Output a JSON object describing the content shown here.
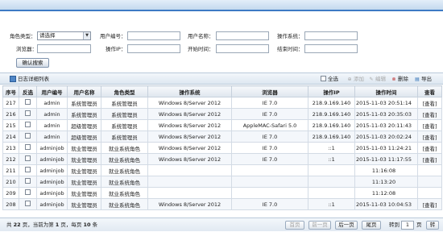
{
  "filter": {
    "role_type_label": "角色类型：",
    "role_type_value": "请选择",
    "user_id_label": "用户编号：",
    "user_name_label": "用户名称：",
    "os_label": "操作系统：",
    "browser_label": "浏览器：",
    "ip_label": "操作IP：",
    "start_time_label": "开始时间：",
    "end_time_label": "结束时间：",
    "search_button": "确认搜索"
  },
  "toolbar": {
    "title": "日志详细列表",
    "select_all": "全选",
    "add": "添加",
    "edit": "编辑",
    "delete": "删除",
    "export": "导出"
  },
  "columns": [
    "序号",
    "反选",
    "用户编号",
    "用户名称",
    "角色类型",
    "操作系统",
    "浏览器",
    "操作IP",
    "操作时间",
    "查看"
  ],
  "rows": [
    {
      "no": "217",
      "uid": "admin",
      "uname": "系统管理员",
      "role": "系统管理员",
      "os": "Windows 8/Server 2012",
      "browser": "IE 7.0",
      "ip": "218.9.169.140",
      "time": "2015-11-03 20:51:14",
      "view": "[查看]"
    },
    {
      "no": "216",
      "uid": "admin",
      "uname": "系统管理员",
      "role": "系统管理员",
      "os": "Windows 8/Server 2012",
      "browser": "IE 7.0",
      "ip": "218.9.169.140",
      "time": "2015-11-03 20:35:03",
      "view": "[查看]"
    },
    {
      "no": "215",
      "uid": "admin",
      "uname": "超级管理员",
      "role": "系统管理员",
      "os": "Windows 8/Server 2012",
      "browser": "AppleMAC-Safari 5.0",
      "ip": "218.9.169.140",
      "time": "2015-11-03 20:11:43",
      "view": "[查看]"
    },
    {
      "no": "214",
      "uid": "admin",
      "uname": "超级管理员",
      "role": "系统管理员",
      "os": "Windows 8/Server 2012",
      "browser": "IE 7.0",
      "ip": "218.9.169.140",
      "time": "2015-11-03 20:02:24",
      "view": "[查看]"
    },
    {
      "no": "213",
      "uid": "adminjob",
      "uname": "就业管理员",
      "role": "就业系统角色",
      "os": "Windows 8/Server 2012",
      "browser": "IE 7.0",
      "ip": "::1",
      "time": "2015-11-03 11:24:21",
      "view": "[查看]"
    },
    {
      "no": "212",
      "uid": "adminjob",
      "uname": "就业管理员",
      "role": "就业系统角色",
      "os": "Windows 8/Server 2012",
      "browser": "IE 7.0",
      "ip": "::1",
      "time": "2015-11-03 11:17:55",
      "view": "[查看]"
    },
    {
      "no": "211",
      "uid": "adminjob",
      "uname": "就业管理员",
      "role": "就业系统角色",
      "os": "",
      "browser": "",
      "ip": "",
      "time": "11:16:08",
      "view": ""
    },
    {
      "no": "210",
      "uid": "adminjob",
      "uname": "就业管理员",
      "role": "就业系统角色",
      "os": "",
      "browser": "",
      "ip": "",
      "time": "11:13:20",
      "view": ""
    },
    {
      "no": "209",
      "uid": "adminjob",
      "uname": "就业管理员",
      "role": "就业系统角色",
      "os": "",
      "browser": "",
      "ip": "",
      "time": "11:12:08",
      "view": ""
    },
    {
      "no": "208",
      "uid": "adminjob",
      "uname": "就业管理员",
      "role": "就业系统角色",
      "os": "Windows 8/Server 2012",
      "browser": "IE 7.0",
      "ip": "::1",
      "time": "2015-11-03 10:04:53",
      "view": "[查看]"
    }
  ],
  "pager": {
    "total_prefix": "共",
    "total_pages": "22",
    "total_mid": "页，当前为第",
    "current_page": "1",
    "per_page_mid": "页，每页",
    "per_page": "10",
    "per_page_suffix": "条",
    "first": "首页",
    "prev": "前一页",
    "next": "后一页",
    "last": "尾页",
    "goto_label": "转到",
    "goto_value": "1",
    "page_unit": "页",
    "go": "转"
  },
  "colors": {
    "accent": "#3d7ac4",
    "header_bg": "#dfe6ee",
    "row_alt": "#f4f7fb"
  }
}
